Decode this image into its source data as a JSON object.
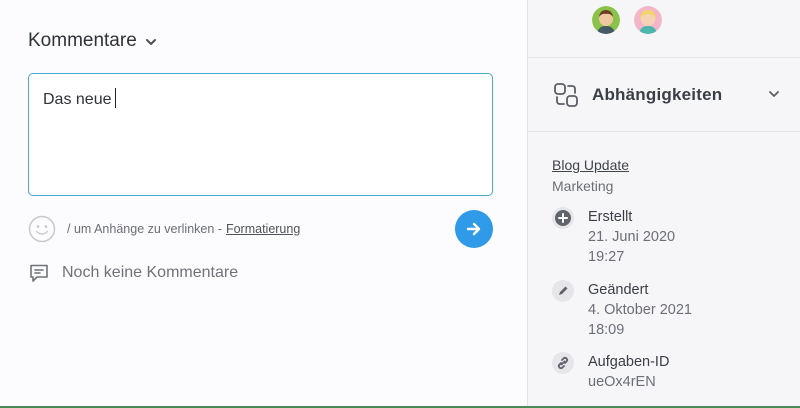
{
  "comments": {
    "title": "Kommentare",
    "input_value": "Das neue",
    "hint_text": "/ um Anhänge zu verlinken -",
    "formatting_link": "Formatierung",
    "empty_text": "Noch keine Kommentare"
  },
  "sidebar": {
    "dependencies_label": "Abhängigkeiten",
    "link_title": "Blog Update",
    "link_subtitle": "Marketing",
    "created": {
      "label": "Erstellt",
      "date": "21. Juni 2020",
      "time": "19:27"
    },
    "changed": {
      "label": "Geändert",
      "date": "4. Oktober 2021",
      "time": "18:09"
    },
    "task_id": {
      "label": "Aufgaben-ID",
      "value": "ueOx4rEN"
    }
  },
  "colors": {
    "accent": "#2f9ae8",
    "input_border": "#49a9cf"
  }
}
